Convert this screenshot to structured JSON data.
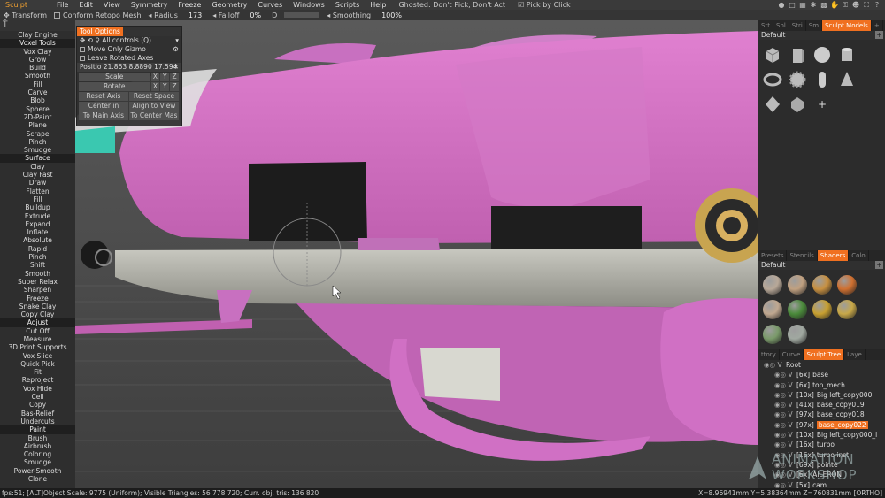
{
  "menubar": {
    "mode": "Sculpt",
    "menus": [
      "File",
      "Edit",
      "View",
      "Symmetry",
      "Freeze",
      "Geometry",
      "Curves",
      "Windows",
      "Scripts",
      "Help"
    ],
    "ghosted": "Ghosted: Don't Pick, Don't Act",
    "pick_by_click": "Pick by Click"
  },
  "toolbar2": {
    "transform": "Transform",
    "conform": "Conform Retopo Mesh",
    "radius_label": "Radius",
    "radius_value": "173",
    "falloff_label": "Falloff",
    "falloff_value": "0%",
    "d_label": "D",
    "smoothing_label": "Smoothing",
    "smoothing_value": "100%"
  },
  "left_panel": {
    "items": [
      {
        "label": "Clay Engine",
        "type": "item"
      },
      {
        "label": "Voxel Tools",
        "type": "sec"
      },
      {
        "label": "Vox Clay",
        "type": "item"
      },
      {
        "label": "Grow",
        "type": "item"
      },
      {
        "label": "Build",
        "type": "item"
      },
      {
        "label": "Smooth",
        "type": "item"
      },
      {
        "label": "Fill",
        "type": "item"
      },
      {
        "label": "Carve",
        "type": "item"
      },
      {
        "label": "Blob",
        "type": "item"
      },
      {
        "label": "Sphere",
        "type": "item"
      },
      {
        "label": "2D-Paint",
        "type": "item"
      },
      {
        "label": "Plane",
        "type": "item"
      },
      {
        "label": "Scrape",
        "type": "item"
      },
      {
        "label": "Pinch",
        "type": "item"
      },
      {
        "label": "Smudge",
        "type": "item"
      },
      {
        "label": "Surface",
        "type": "sec"
      },
      {
        "label": "Clay",
        "type": "item"
      },
      {
        "label": "Clay Fast",
        "type": "item"
      },
      {
        "label": "Draw",
        "type": "item"
      },
      {
        "label": "Flatten",
        "type": "item"
      },
      {
        "label": "Fill",
        "type": "item"
      },
      {
        "label": "Buildup",
        "type": "item"
      },
      {
        "label": "Extrude",
        "type": "item"
      },
      {
        "label": "Expand",
        "type": "item"
      },
      {
        "label": "Inflate",
        "type": "item"
      },
      {
        "label": "Absolute",
        "type": "item"
      },
      {
        "label": "Rapid",
        "type": "item"
      },
      {
        "label": "Pinch",
        "type": "item"
      },
      {
        "label": "Shift",
        "type": "item"
      },
      {
        "label": "Smooth",
        "type": "item"
      },
      {
        "label": "Super Relax",
        "type": "item"
      },
      {
        "label": "Sharpen",
        "type": "item"
      },
      {
        "label": "Freeze",
        "type": "item"
      },
      {
        "label": "Snake Clay",
        "type": "item"
      },
      {
        "label": "Copy Clay",
        "type": "item"
      },
      {
        "label": "Adjust",
        "type": "sec"
      },
      {
        "label": "Cut Off",
        "type": "item"
      },
      {
        "label": "Measure",
        "type": "item"
      },
      {
        "label": "3D Print Supports",
        "type": "item"
      },
      {
        "label": "Vox Slice",
        "type": "item"
      },
      {
        "label": "Quick Pick",
        "type": "item"
      },
      {
        "label": "Fit",
        "type": "item"
      },
      {
        "label": "Reproject",
        "type": "item"
      },
      {
        "label": "Vox Hide",
        "type": "item"
      },
      {
        "label": "Cell",
        "type": "item"
      },
      {
        "label": "Copy",
        "type": "item"
      },
      {
        "label": "Bas-Relief",
        "type": "item"
      },
      {
        "label": "Undercuts",
        "type": "item"
      },
      {
        "label": "Paint",
        "type": "sec"
      },
      {
        "label": "Brush",
        "type": "item"
      },
      {
        "label": "Airbrush",
        "type": "item"
      },
      {
        "label": "Coloring",
        "type": "item"
      },
      {
        "label": "Smudge",
        "type": "item"
      },
      {
        "label": "Power-Smooth",
        "type": "item"
      },
      {
        "label": "Clone",
        "type": "item"
      }
    ]
  },
  "tool_options": {
    "tab": "Tool Options",
    "controls": "All controls (Q)",
    "move_only_gizmo": "Move Only Gizmo",
    "leave_rotated": "Leave Rotated Axes",
    "position_label": "Positio",
    "pos_x": "21.863",
    "pos_y": "8.8890",
    "pos_z": "17.594",
    "scale": "Scale",
    "rotate": "Rotate",
    "x": "X",
    "y": "Y",
    "z": "Z",
    "reset_axis": "Reset Axis",
    "reset_space": "Reset Space",
    "center_in_local": "Center in Local",
    "align_to_view": "Align to View",
    "to_main_axis": "To Main Axis",
    "to_center_mass": "To Center Mas"
  },
  "right_panel": {
    "tabs_top": [
      "Stt",
      "Spl",
      "Stri",
      "Sm",
      "Sculpt Models",
      "+"
    ],
    "active_tab_top": "Sculpt Models",
    "default_label": "Default",
    "shader_tabs": [
      "Presets",
      "Stencils",
      "Shaders",
      "Colo"
    ],
    "active_shader_tab": "Shaders",
    "shader_default": "Default",
    "shader_colors": [
      "#b8a898",
      "#c0a080",
      "#c89040",
      "#d07030",
      "#c0a890",
      "#4a8a3a",
      "#c8a030",
      "#c8a848",
      "#7a9a6a",
      "#a0a8a0"
    ],
    "tree_tabs": [
      "ttory",
      "Curve",
      "Sculpt Tree",
      "Laye"
    ],
    "active_tree_tab": "Sculpt Tree",
    "tree": [
      {
        "prefix": "",
        "name": "Root",
        "level": 0,
        "sel": false
      },
      {
        "prefix": "[6x]",
        "name": "base",
        "level": 1,
        "sel": false
      },
      {
        "prefix": "[6x]",
        "name": "top_mech",
        "level": 1,
        "sel": false
      },
      {
        "prefix": "[10x]",
        "name": "Big left_copy000",
        "level": 1,
        "sel": false
      },
      {
        "prefix": "[41x]",
        "name": "base_copy019",
        "level": 1,
        "sel": false
      },
      {
        "prefix": "[97x]",
        "name": "base_copy018",
        "level": 1,
        "sel": false
      },
      {
        "prefix": "[97x]",
        "name": "base_copy022",
        "level": 1,
        "sel": true
      },
      {
        "prefix": "[10x]",
        "name": "Big left_copy000_l",
        "level": 1,
        "sel": false
      },
      {
        "prefix": "[16x]",
        "name": "turbo",
        "level": 1,
        "sel": false
      },
      {
        "prefix": "[16x]",
        "name": "turbo inst",
        "level": 1,
        "sel": false
      },
      {
        "prefix": "[69x]",
        "name": "pointe",
        "level": 1,
        "sel": false
      },
      {
        "prefix": "[6x]",
        "name": "AILERON",
        "level": 1,
        "sel": false
      },
      {
        "prefix": "[5x]",
        "name": "cam",
        "level": 1,
        "sel": false
      }
    ]
  },
  "statusbar": {
    "left": "fps:51;   [ALT]Object Scale: 9775 (Uniform); Visible Triangles: 56 778 720; Curr. obj. tris: 136 820",
    "right": "X=8.96941mm  Y=5.38364mm  Z=760831mm  [ORTHO]"
  },
  "watermark": {
    "line1": "ANIMATION",
    "line2": "WORKSHOP"
  }
}
